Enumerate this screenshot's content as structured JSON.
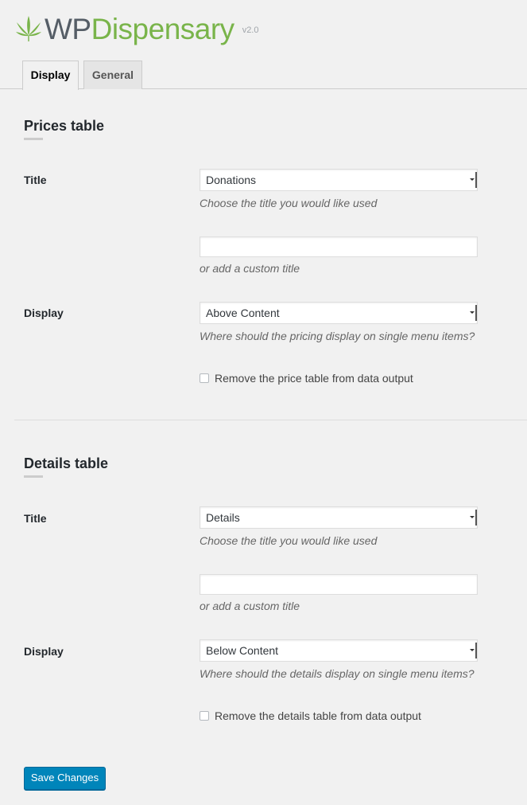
{
  "header": {
    "brand_wp": "WP",
    "brand_dispensary": "Dispensary",
    "version": "v2.0",
    "brand_color": "#79b44a",
    "icon": "cannabis-leaf-icon"
  },
  "tabs": [
    {
      "label": "Display",
      "active": true
    },
    {
      "label": "General",
      "active": false
    }
  ],
  "sections": [
    {
      "title": "Prices table",
      "title_label": "Title",
      "title_select_value": "Donations",
      "title_help": "Choose the title you would like used",
      "custom_title_value": "",
      "custom_title_help": "or add a custom title",
      "display_label": "Display",
      "display_select_value": "Above Content",
      "display_help": "Where should the pricing display on single menu items?",
      "checkbox_label": "Remove the price table from data output",
      "checkbox_checked": false
    },
    {
      "title": "Details table",
      "title_label": "Title",
      "title_select_value": "Details",
      "title_help": "Choose the title you would like used",
      "custom_title_value": "",
      "custom_title_help": "or add a custom title",
      "display_label": "Display",
      "display_select_value": "Below Content",
      "display_help": "Where should the details display on single menu items?",
      "checkbox_label": "Remove the details table from data output",
      "checkbox_checked": false
    }
  ],
  "save_button_label": "Save Changes",
  "save_button_color": "#0085ba"
}
